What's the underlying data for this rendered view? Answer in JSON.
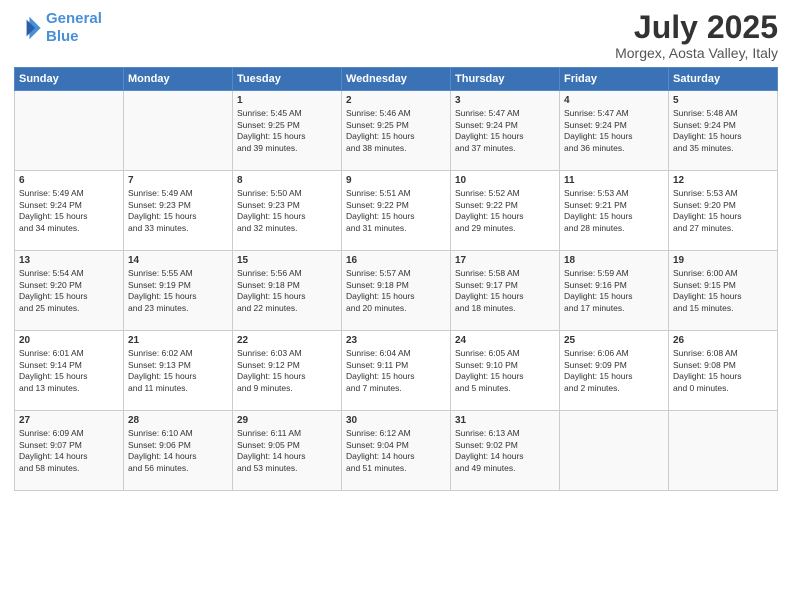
{
  "header": {
    "logo_line1": "General",
    "logo_line2": "Blue",
    "title": "July 2025",
    "subtitle": "Morgex, Aosta Valley, Italy"
  },
  "days_of_week": [
    "Sunday",
    "Monday",
    "Tuesday",
    "Wednesday",
    "Thursday",
    "Friday",
    "Saturday"
  ],
  "weeks": [
    [
      {
        "day": "",
        "content": ""
      },
      {
        "day": "",
        "content": ""
      },
      {
        "day": "1",
        "content": "Sunrise: 5:45 AM\nSunset: 9:25 PM\nDaylight: 15 hours\nand 39 minutes."
      },
      {
        "day": "2",
        "content": "Sunrise: 5:46 AM\nSunset: 9:25 PM\nDaylight: 15 hours\nand 38 minutes."
      },
      {
        "day": "3",
        "content": "Sunrise: 5:47 AM\nSunset: 9:24 PM\nDaylight: 15 hours\nand 37 minutes."
      },
      {
        "day": "4",
        "content": "Sunrise: 5:47 AM\nSunset: 9:24 PM\nDaylight: 15 hours\nand 36 minutes."
      },
      {
        "day": "5",
        "content": "Sunrise: 5:48 AM\nSunset: 9:24 PM\nDaylight: 15 hours\nand 35 minutes."
      }
    ],
    [
      {
        "day": "6",
        "content": "Sunrise: 5:49 AM\nSunset: 9:24 PM\nDaylight: 15 hours\nand 34 minutes."
      },
      {
        "day": "7",
        "content": "Sunrise: 5:49 AM\nSunset: 9:23 PM\nDaylight: 15 hours\nand 33 minutes."
      },
      {
        "day": "8",
        "content": "Sunrise: 5:50 AM\nSunset: 9:23 PM\nDaylight: 15 hours\nand 32 minutes."
      },
      {
        "day": "9",
        "content": "Sunrise: 5:51 AM\nSunset: 9:22 PM\nDaylight: 15 hours\nand 31 minutes."
      },
      {
        "day": "10",
        "content": "Sunrise: 5:52 AM\nSunset: 9:22 PM\nDaylight: 15 hours\nand 29 minutes."
      },
      {
        "day": "11",
        "content": "Sunrise: 5:53 AM\nSunset: 9:21 PM\nDaylight: 15 hours\nand 28 minutes."
      },
      {
        "day": "12",
        "content": "Sunrise: 5:53 AM\nSunset: 9:20 PM\nDaylight: 15 hours\nand 27 minutes."
      }
    ],
    [
      {
        "day": "13",
        "content": "Sunrise: 5:54 AM\nSunset: 9:20 PM\nDaylight: 15 hours\nand 25 minutes."
      },
      {
        "day": "14",
        "content": "Sunrise: 5:55 AM\nSunset: 9:19 PM\nDaylight: 15 hours\nand 23 minutes."
      },
      {
        "day": "15",
        "content": "Sunrise: 5:56 AM\nSunset: 9:18 PM\nDaylight: 15 hours\nand 22 minutes."
      },
      {
        "day": "16",
        "content": "Sunrise: 5:57 AM\nSunset: 9:18 PM\nDaylight: 15 hours\nand 20 minutes."
      },
      {
        "day": "17",
        "content": "Sunrise: 5:58 AM\nSunset: 9:17 PM\nDaylight: 15 hours\nand 18 minutes."
      },
      {
        "day": "18",
        "content": "Sunrise: 5:59 AM\nSunset: 9:16 PM\nDaylight: 15 hours\nand 17 minutes."
      },
      {
        "day": "19",
        "content": "Sunrise: 6:00 AM\nSunset: 9:15 PM\nDaylight: 15 hours\nand 15 minutes."
      }
    ],
    [
      {
        "day": "20",
        "content": "Sunrise: 6:01 AM\nSunset: 9:14 PM\nDaylight: 15 hours\nand 13 minutes."
      },
      {
        "day": "21",
        "content": "Sunrise: 6:02 AM\nSunset: 9:13 PM\nDaylight: 15 hours\nand 11 minutes."
      },
      {
        "day": "22",
        "content": "Sunrise: 6:03 AM\nSunset: 9:12 PM\nDaylight: 15 hours\nand 9 minutes."
      },
      {
        "day": "23",
        "content": "Sunrise: 6:04 AM\nSunset: 9:11 PM\nDaylight: 15 hours\nand 7 minutes."
      },
      {
        "day": "24",
        "content": "Sunrise: 6:05 AM\nSunset: 9:10 PM\nDaylight: 15 hours\nand 5 minutes."
      },
      {
        "day": "25",
        "content": "Sunrise: 6:06 AM\nSunset: 9:09 PM\nDaylight: 15 hours\nand 2 minutes."
      },
      {
        "day": "26",
        "content": "Sunrise: 6:08 AM\nSunset: 9:08 PM\nDaylight: 15 hours\nand 0 minutes."
      }
    ],
    [
      {
        "day": "27",
        "content": "Sunrise: 6:09 AM\nSunset: 9:07 PM\nDaylight: 14 hours\nand 58 minutes."
      },
      {
        "day": "28",
        "content": "Sunrise: 6:10 AM\nSunset: 9:06 PM\nDaylight: 14 hours\nand 56 minutes."
      },
      {
        "day": "29",
        "content": "Sunrise: 6:11 AM\nSunset: 9:05 PM\nDaylight: 14 hours\nand 53 minutes."
      },
      {
        "day": "30",
        "content": "Sunrise: 6:12 AM\nSunset: 9:04 PM\nDaylight: 14 hours\nand 51 minutes."
      },
      {
        "day": "31",
        "content": "Sunrise: 6:13 AM\nSunset: 9:02 PM\nDaylight: 14 hours\nand 49 minutes."
      },
      {
        "day": "",
        "content": ""
      },
      {
        "day": "",
        "content": ""
      }
    ]
  ]
}
